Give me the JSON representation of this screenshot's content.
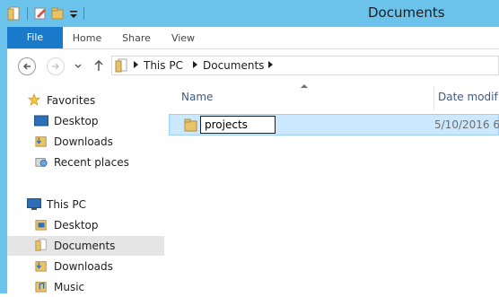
{
  "window": {
    "title": "Documents"
  },
  "ribbon": {
    "tabs": [
      {
        "label": "File"
      },
      {
        "label": "Home"
      },
      {
        "label": "Share"
      },
      {
        "label": "View"
      }
    ]
  },
  "address": {
    "crumbs": [
      "This PC",
      "Documents"
    ]
  },
  "nav": {
    "favorites": {
      "label": "Favorites",
      "items": [
        {
          "label": "Desktop"
        },
        {
          "label": "Downloads"
        },
        {
          "label": "Recent places"
        }
      ]
    },
    "thispc": {
      "label": "This PC",
      "items": [
        {
          "label": "Desktop"
        },
        {
          "label": "Documents"
        },
        {
          "label": "Downloads"
        },
        {
          "label": "Music"
        }
      ]
    }
  },
  "columns": {
    "name": "Name",
    "date": "Date modif"
  },
  "files": [
    {
      "name": "projects",
      "date": "5/10/2016 6"
    }
  ],
  "colors": {
    "titlebar": "#6bc3eb",
    "file_tab": "#1979ca",
    "selection": "#cce8ff"
  }
}
